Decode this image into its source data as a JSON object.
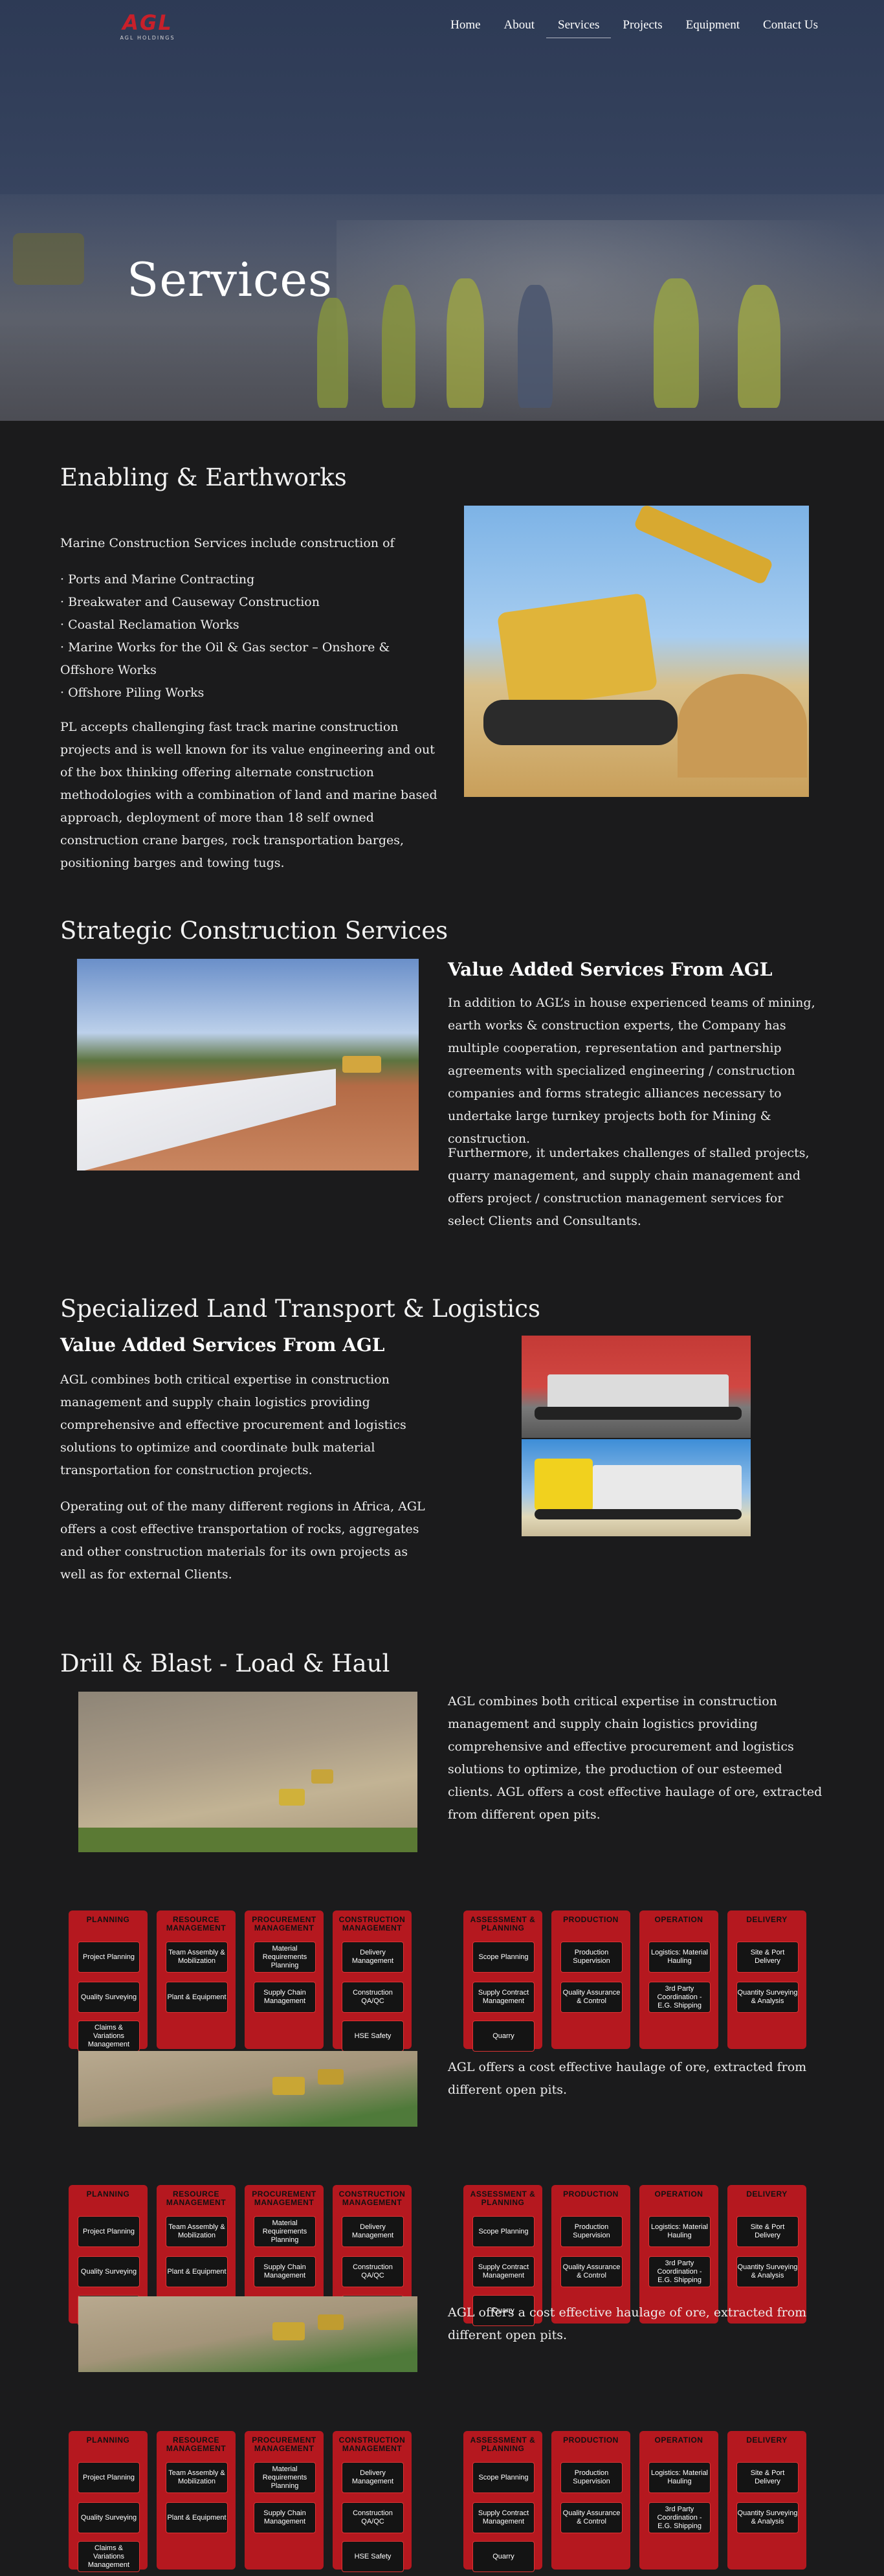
{
  "header": {
    "logo_text": "AGL",
    "logo_sub": "AGL HOLDINGS",
    "nav": [
      {
        "label": "Home"
      },
      {
        "label": "About"
      },
      {
        "label": "Services"
      },
      {
        "label": "Projects"
      },
      {
        "label": "Equipment"
      },
      {
        "label": "Contact Us"
      }
    ],
    "active": "Services"
  },
  "hero": {
    "title": "Services"
  },
  "enabling": {
    "title": "Enabling & Earthworks",
    "intro": "Marine Construction Services include construction of",
    "items": [
      "· Ports and Marine Contracting",
      "· Breakwater and Causeway Construction",
      "· Coastal Reclamation Works",
      "· Marine Works for the Oil & Gas sector – Onshore & Offshore Works",
      "· Offshore Piling Works"
    ],
    "body": "PL accepts challenging fast track marine construction projects and is well known for its value engineering and out of the box thinking offering alternate construction methodologies with a combination of land and marine based approach, deployment of more than 18 self owned construction crane barges, rock transportation barges, positioning barges and towing tugs."
  },
  "strategic": {
    "title": "Strategic Construction Services",
    "subtitle": "Value Added Services From AGL",
    "para1": "In addition to AGL’s in house experienced teams of mining, earth works & construction experts, the Company has multiple cooperation, representation and partnership agreements with specialized engineering / construction companies and forms strategic alliances necessary to undertake large turnkey projects both for Mining & construction.",
    "para2": "Furthermore, it undertakes challenges of stalled projects, quarry management, and supply chain management and offers project / construction management services for select Clients and Consultants."
  },
  "transport": {
    "title": "Specialized Land Transport & Logistics",
    "subtitle": "Value Added Services From AGL",
    "para1": "AGL combines both critical expertise in construction management and supply chain logistics providing comprehensive and effective procurement and logistics solutions to optimize and coordinate bulk material transportation for construction projects.",
    "para2": "Operating out of the many different regions in Africa, AGL offers a cost effective transportation of rocks, aggregates and other construction materials for its own projects as well as for external Clients."
  },
  "drill": {
    "title": "Drill & Blast - Load & Haul",
    "para": "AGL combines both critical expertise in construction management and supply chain logistics providing comprehensive and effective procurement and logistics solutions to optimize, the production of our esteemed clients. AGL offers a cost effective haulage of ore, extracted from different open pits.",
    "repeat": "AGL offers a cost effective haulage of ore, extracted from different open pits."
  },
  "process_left": [
    {
      "head": "PLANNING",
      "boxes": [
        "Project Planning",
        "Quality Surveying",
        "Claims & Variations Management"
      ]
    },
    {
      "head": "RESOURCE MANAGEMENT",
      "boxes": [
        "Team Assembly & Mobilization",
        "Plant & Equipment"
      ]
    },
    {
      "head": "PROCUREMENT MANAGEMENT",
      "boxes": [
        "Material Requirements Planning",
        "Supply Chain Management"
      ]
    },
    {
      "head": "CONSTRUCTION MANAGEMENT",
      "boxes": [
        "Delivery Management",
        "Construction QA/QC",
        "HSE Safety"
      ]
    }
  ],
  "process_right": [
    {
      "head": "ASSESSMENT & PLANNING",
      "boxes": [
        "Scope Planning",
        "Supply Contract Management",
        "Quarry"
      ]
    },
    {
      "head": "PRODUCTION",
      "boxes": [
        "Production Supervision",
        "Quality Assurance & Control"
      ]
    },
    {
      "head": "OPERATION",
      "boxes": [
        "Logistics: Material Hauling",
        "3rd Party Coordination - E.G. Shipping"
      ]
    },
    {
      "head": "DELIVERY",
      "boxes": [
        "Site & Port Delivery",
        "Quantity Surveying & Analysis"
      ]
    }
  ],
  "colors": {
    "background": "#1b1b1c",
    "accent_red": "#b5181f",
    "text": "#ededed"
  }
}
